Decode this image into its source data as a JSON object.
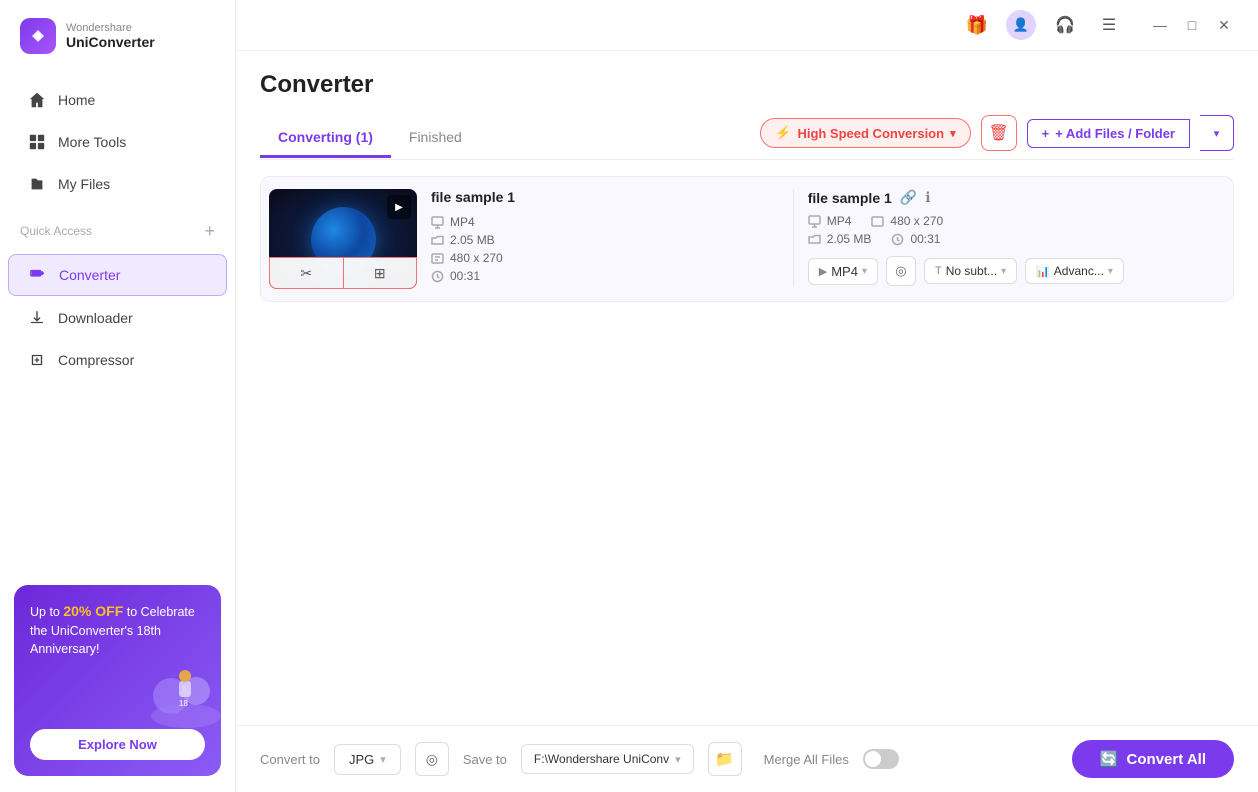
{
  "app": {
    "brand": "Wondershare",
    "name": "UniConverter"
  },
  "sidebar": {
    "items": [
      {
        "id": "home",
        "label": "Home",
        "icon": "home"
      },
      {
        "id": "more-tools",
        "label": "More Tools",
        "icon": "grid"
      },
      {
        "id": "my-files",
        "label": "My Files",
        "icon": "files"
      }
    ],
    "section_label": "Quick Access",
    "quick_items": [
      {
        "id": "converter",
        "label": "Converter",
        "icon": "converter",
        "active": true
      },
      {
        "id": "downloader",
        "label": "Downloader",
        "icon": "downloader"
      },
      {
        "id": "compressor",
        "label": "Compressor",
        "icon": "compressor"
      }
    ]
  },
  "promo": {
    "line1": "Up to ",
    "discount": "20% OFF",
    "line2": " to Celebrate the UniConverter's 18th Anniversary!",
    "button_label": "Explore Now"
  },
  "topbar": {
    "gift_icon": "gift",
    "avatar_icon": "user",
    "headphones_icon": "headphones",
    "menu_icon": "menu",
    "minimize": "—",
    "maximize": "□",
    "close": "✕"
  },
  "converter": {
    "page_title": "Converter",
    "tabs": [
      {
        "id": "converting",
        "label": "Converting (1)",
        "active": true
      },
      {
        "id": "finished",
        "label": "Finished",
        "active": false
      }
    ],
    "high_speed_btn": "High Speed Conversion",
    "delete_btn": "delete",
    "add_files_btn": "+ Add Files / Folder",
    "files": [
      {
        "id": "file1",
        "name": "file sample 1",
        "source": {
          "format": "MP4",
          "resolution": "480 x 270",
          "size": "2.05 MB",
          "duration": "00:31"
        },
        "output": {
          "name": "file sample 1",
          "format": "MP4",
          "resolution": "480 x 270",
          "size": "2.05 MB",
          "duration": "00:31",
          "subtitle": "No subt...",
          "advanced": "Advanc..."
        }
      }
    ]
  },
  "bottom_bar": {
    "convert_to_label": "Convert to",
    "format": "JPG",
    "save_to_label": "Save to",
    "save_path": "F:\\Wondershare UniConv",
    "merge_label": "Merge All Files",
    "convert_all_btn": "Convert All"
  }
}
